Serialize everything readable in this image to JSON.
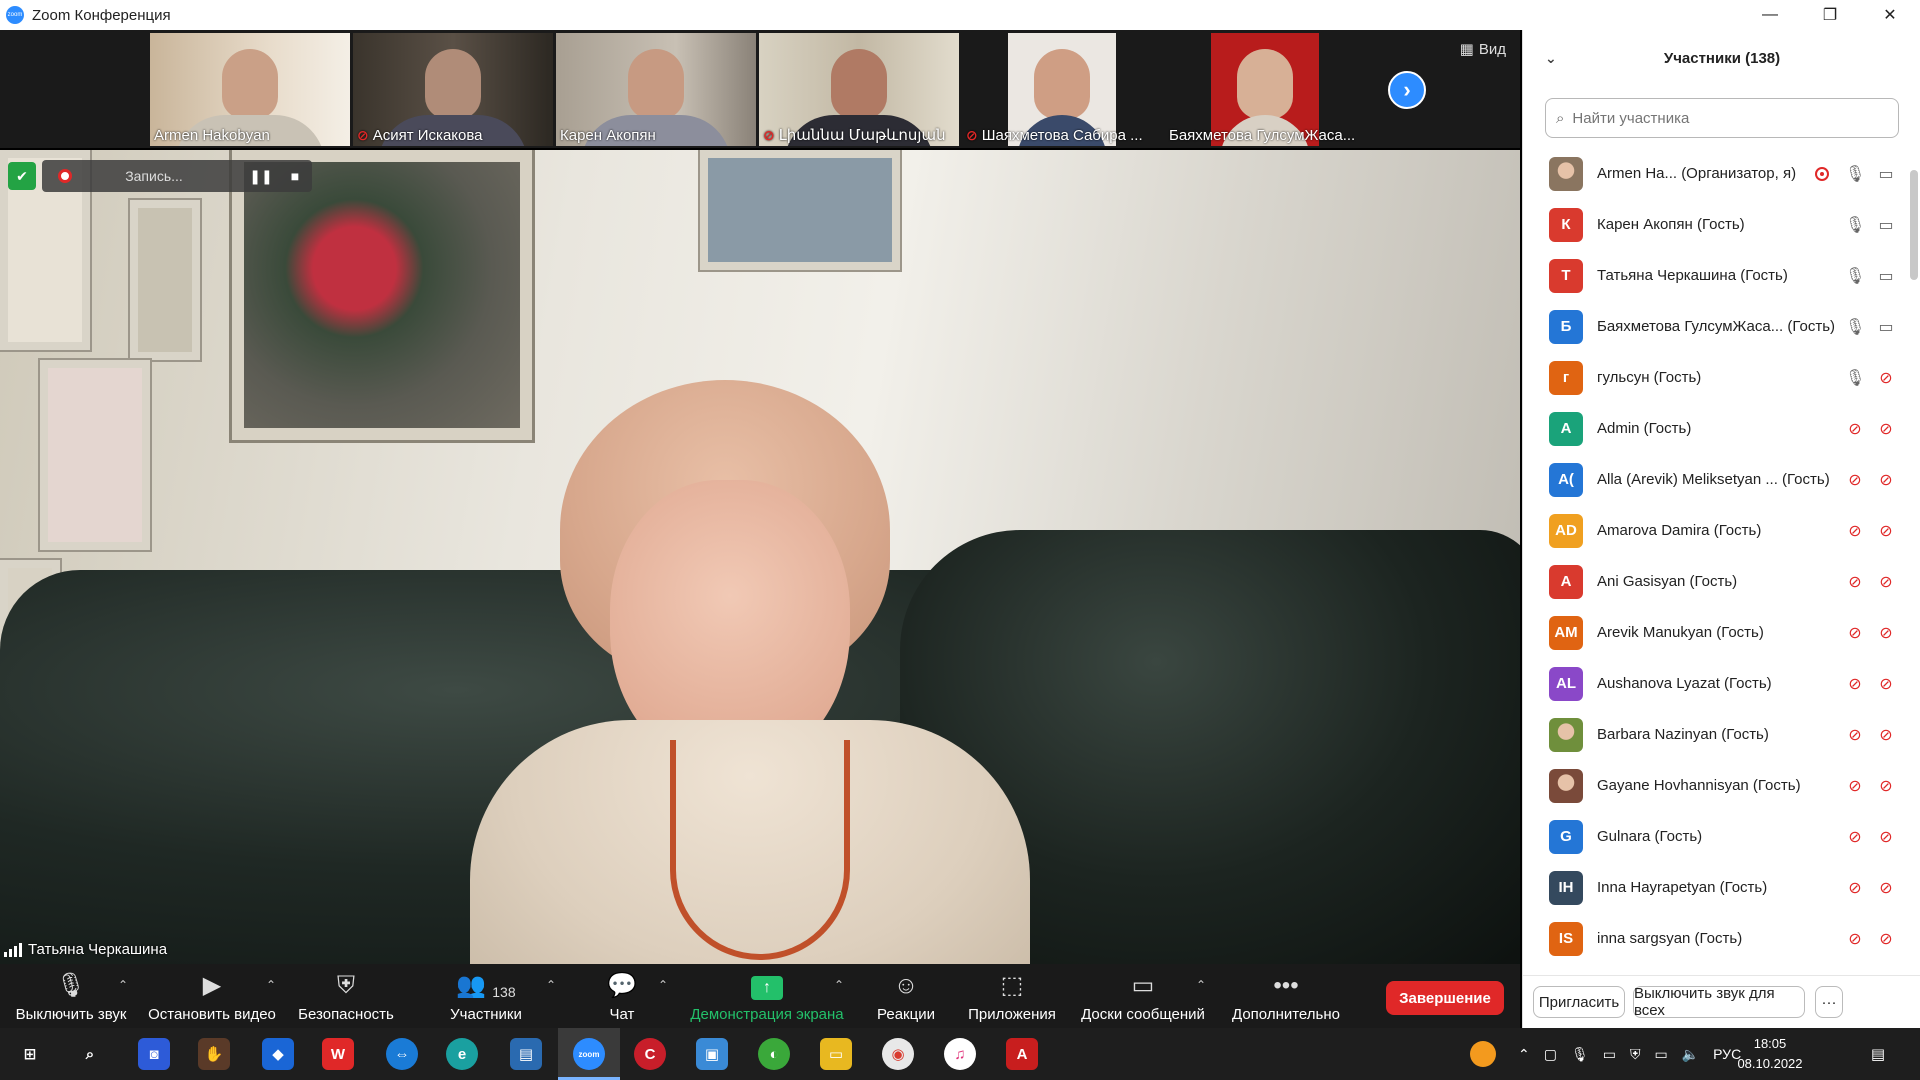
{
  "window": {
    "title": "Zoom Конференция",
    "minimize": "—",
    "maximize": "❐",
    "close": "✕"
  },
  "strip": {
    "view_label": "Вид",
    "thumbnails": [
      {
        "name": "Armen Hakobyan",
        "muted": false
      },
      {
        "name": "Асият Искакова",
        "muted": true
      },
      {
        "name": "Карен Акопян",
        "muted": false
      },
      {
        "name": "Լիաննա Մաթևոսյան",
        "muted": true
      },
      {
        "name": "Шаяхметова Сабира ...",
        "muted": true
      },
      {
        "name": "Баяхметова ГулсумЖаса...",
        "muted": false
      }
    ]
  },
  "recording": {
    "label": "Запись..."
  },
  "main_video": {
    "speaker_name": "Татьяна Черкашина"
  },
  "toolbar": {
    "mute": "Выключить звук",
    "stop_video": "Остановить видео",
    "security": "Безопасность",
    "participants": "Участники",
    "participants_count": "138",
    "chat": "Чат",
    "share_screen": "Демонстрация экрана",
    "reactions": "Реакции",
    "apps": "Приложения",
    "whiteboards": "Доски сообщений",
    "more": "Дополнительно",
    "end": "Завершение"
  },
  "participants_panel": {
    "title": "Участники (138)",
    "search_placeholder": "Найти участника",
    "invite": "Пригласить",
    "mute_all": "Выключить звук для всех",
    "more": "···",
    "items": [
      {
        "name": "Armen Ha...  (Организатор, я)",
        "initials": "",
        "color": "#8a7560",
        "photo": true,
        "mic_muted": false,
        "cam_off": false,
        "recording": true
      },
      {
        "name": "Карен Акопян (Гость)",
        "initials": "К",
        "color": "#d93a2e",
        "mic_muted": false,
        "cam_off": false
      },
      {
        "name": "Татьяна Черкашина (Гость)",
        "initials": "Т",
        "color": "#d93a2e",
        "mic_muted": false,
        "cam_off": false
      },
      {
        "name": "Баяхметова ГулсумЖаса...  (Гость)",
        "initials": "Б",
        "color": "#2476d6",
        "mic_muted": false,
        "cam_off": false
      },
      {
        "name": "гульсун (Гость)",
        "initials": "г",
        "color": "#e06412",
        "mic_muted": false,
        "cam_off": true
      },
      {
        "name": "Admin (Гость)",
        "initials": "A",
        "color": "#1aa37a",
        "mic_muted": true,
        "cam_off": true
      },
      {
        "name": "Alla (Arevik) Meliksetyan ... (Гость)",
        "initials": "A(",
        "color": "#2476d6",
        "mic_muted": true,
        "cam_off": true
      },
      {
        "name": "Amarova Damira (Гость)",
        "initials": "AD",
        "color": "#f0a020",
        "mic_muted": true,
        "cam_off": true
      },
      {
        "name": "Ani Gasisyan (Гость)",
        "initials": "A",
        "color": "#d93a2e",
        "mic_muted": true,
        "cam_off": true
      },
      {
        "name": "Arevik Manukyan (Гость)",
        "initials": "AM",
        "color": "#e06412",
        "mic_muted": true,
        "cam_off": true
      },
      {
        "name": "Aushanova Lyazat (Гость)",
        "initials": "AL",
        "color": "#8a48c8",
        "mic_muted": true,
        "cam_off": true
      },
      {
        "name": "Barbara Nazinyan (Гость)",
        "initials": "",
        "color": "#6f8f3c",
        "photo": true,
        "mic_muted": true,
        "cam_off": true
      },
      {
        "name": "Gayane Hovhannisyan (Гость)",
        "initials": "",
        "color": "#7a4a3a",
        "photo": true,
        "mic_muted": true,
        "cam_off": true
      },
      {
        "name": "Gulnara (Гость)",
        "initials": "G",
        "color": "#2476d6",
        "mic_muted": true,
        "cam_off": true
      },
      {
        "name": "Inna Hayrapetyan (Гость)",
        "initials": "IH",
        "color": "#34495e",
        "mic_muted": true,
        "cam_off": true
      },
      {
        "name": "inna sargsyan (Гость)",
        "initials": "IS",
        "color": "#e06412",
        "mic_muted": true,
        "cam_off": true
      }
    ]
  },
  "taskbar": {
    "language": "РУС",
    "time": "18:05",
    "date": "08.10.2022"
  }
}
